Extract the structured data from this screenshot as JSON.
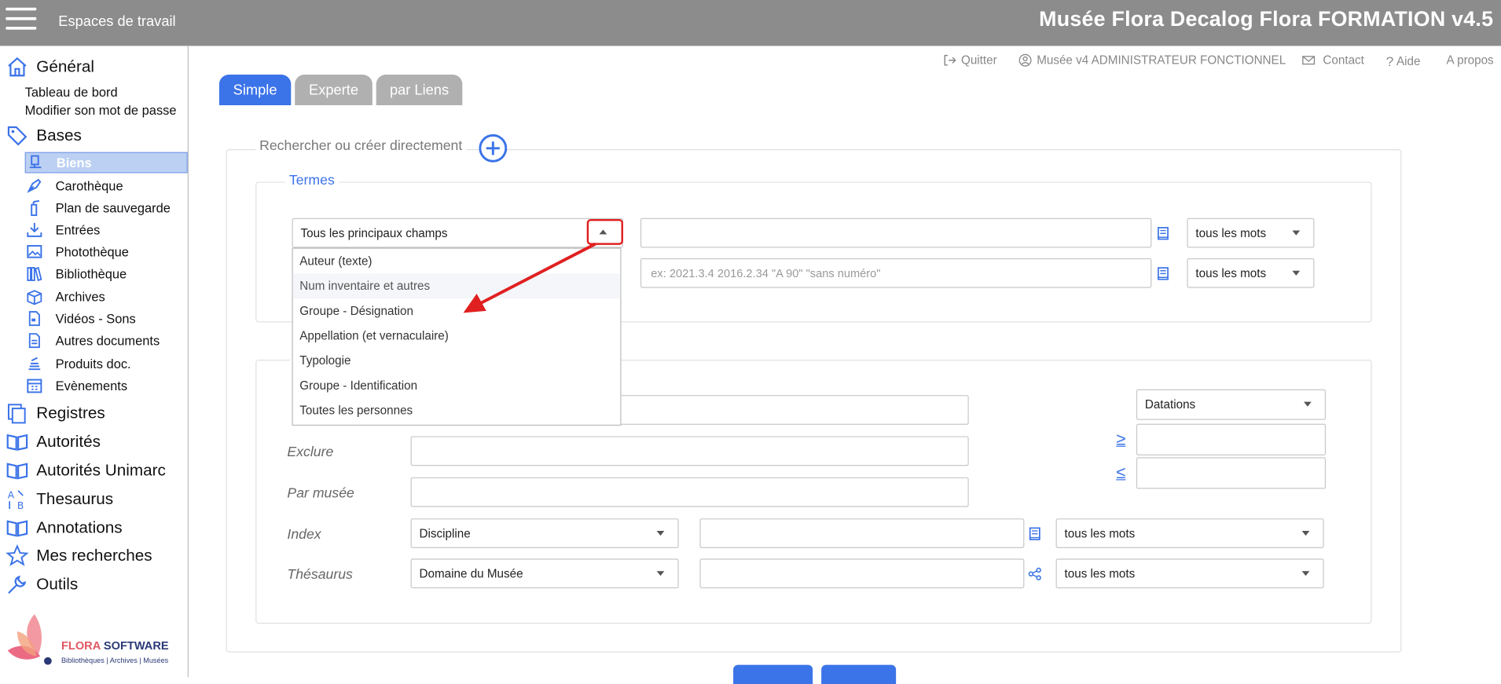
{
  "header": {
    "menu_icon": "hamburger-icon",
    "workspaces": "Espaces de travail",
    "title": "Musée Flora Decalog Flora FORMATION v4.5"
  },
  "sidebar": {
    "general": {
      "label": "Général",
      "icon": "home-icon",
      "links": [
        "Tableau de bord",
        "Modifier son mot de passe"
      ]
    },
    "bases": {
      "label": "Bases",
      "icon": "tag-icon",
      "items": [
        "Biens",
        "Carothèque",
        "Plan de sauvegarde",
        "Entrées",
        "Photothèque",
        "Bibliothèque",
        "Archives",
        "Vidéos - Sons",
        "Autres documents",
        "Produits doc.",
        "Evènements"
      ]
    },
    "sections": [
      "Registres",
      "Autorités",
      "Autorités Unimarc",
      "Thesaurus",
      "Annotations",
      "Mes recherches",
      "Outils"
    ],
    "logo": {
      "brand1": "FLORA",
      "brand2": "SOFTWARE",
      "tagline": "Bibliothèques | Archives | Musées"
    }
  },
  "toplinks": {
    "quit": "Quitter",
    "user": "Musée v4 ADMINISTRATEUR FONCTIONNEL",
    "contact": "Contact",
    "help": "Aide",
    "about": "A propos"
  },
  "tabs": [
    "Simple",
    "Experte",
    "par Liens"
  ],
  "search": {
    "legend": "Rechercher ou créer directement",
    "terms_legend": "Termes",
    "field_select": "Tous les principaux champs",
    "placeholder2": "ex: 2021.3.4 2016.2.34 \"A 90\" \"sans numéro\"",
    "mode1": "tous les mots",
    "mode2": "tous les mots",
    "dropdown_options": [
      "Auteur (texte)",
      "Num inventaire et autres",
      "Groupe - Désignation",
      "Appellation (et vernaculaire)",
      "Typologie",
      "Groupe - Identification",
      "Toutes les personnes"
    ]
  },
  "filters": {
    "exclure": "Exclure",
    "par_musee": "Par musée",
    "index": "Index",
    "thesaurus": "Thésaurus",
    "index_select": "Discipline",
    "thesaurus_select": "Domaine du Musée",
    "index_mode": "tous les mots",
    "thesaurus_mode": "tous les mots",
    "datations": "Datations",
    "gte": "≥",
    "lte": "≤"
  },
  "colors": {
    "accent": "#3b73e8",
    "header": "#8c8c8c",
    "annotation": "#e02020"
  }
}
